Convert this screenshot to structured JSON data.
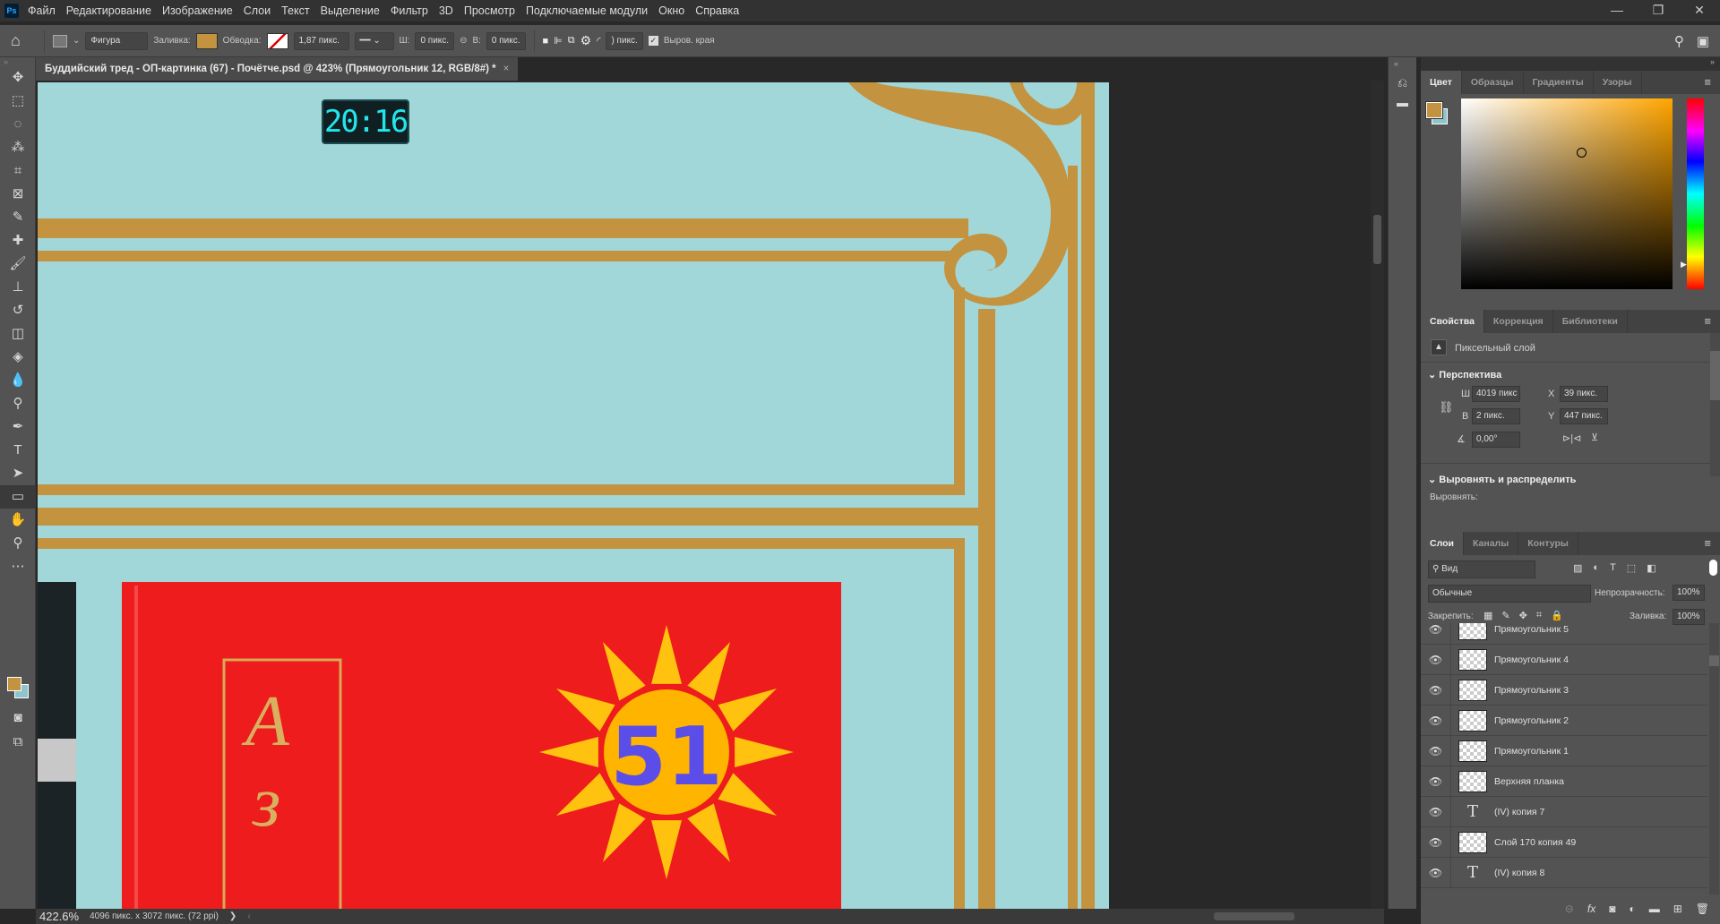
{
  "app": {
    "logo": "Ps"
  },
  "menu": [
    "Файл",
    "Редактирование",
    "Изображение",
    "Слои",
    "Текст",
    "Выделение",
    "Фильтр",
    "3D",
    "Просмотр",
    "Подключаемые модули",
    "Окно",
    "Справка"
  ],
  "window_controls": {
    "minimize": "—",
    "restore": "❐",
    "close": "✕"
  },
  "options": {
    "mode": "Фигура",
    "fill_label": "Заливка:",
    "fill_color": "#c39340",
    "stroke_label": "Обводка:",
    "stroke_width": "1,87 пикс.",
    "w_label": "Ш:",
    "w_value": "0 пикс.",
    "h_label": "В:",
    "h_value": "0 пикс.",
    "radius": ") пикс.",
    "align_edges": "Выров. края",
    "align_edges_checked": true
  },
  "document": {
    "tab_title": "Буддийский тред - ОП-картинка (67) - Почётче.psd @ 423% (Прямоугольник 12, RGB/8#) *",
    "close": "×"
  },
  "canvas": {
    "clock": "20:16",
    "badge_number": "51",
    "background": "#a2d7da",
    "gold": "#c39340"
  },
  "status": {
    "zoom": "422.6%",
    "doc_info": "4096 пикс. x 3072 пикс. (72 ppi)",
    "arrow": "❯"
  },
  "tools": [
    {
      "icon": "move-icon",
      "glyph": "✥"
    },
    {
      "icon": "marquee-icon",
      "glyph": "⬚"
    },
    {
      "icon": "lasso-icon",
      "glyph": "◌"
    },
    {
      "icon": "magic-wand-icon",
      "glyph": "⁂"
    },
    {
      "icon": "crop-icon",
      "glyph": "⌗"
    },
    {
      "icon": "frame-icon",
      "glyph": "⊠"
    },
    {
      "icon": "eyedropper-icon",
      "glyph": "✎"
    },
    {
      "icon": "healing-brush-icon",
      "glyph": "✚"
    },
    {
      "icon": "brush-icon",
      "glyph": "🖌"
    },
    {
      "icon": "stamp-icon",
      "glyph": "⊥"
    },
    {
      "icon": "history-brush-icon",
      "glyph": "↺"
    },
    {
      "icon": "eraser-icon",
      "glyph": "◫"
    },
    {
      "icon": "paint-bucket-icon",
      "glyph": "◈"
    },
    {
      "icon": "blur-icon",
      "glyph": "💧"
    },
    {
      "icon": "dodge-icon",
      "glyph": "⚲"
    },
    {
      "icon": "pen-icon",
      "glyph": "✒"
    },
    {
      "icon": "type-icon",
      "glyph": "T"
    },
    {
      "icon": "path-selection-icon",
      "glyph": "➤"
    },
    {
      "icon": "rectangle-icon",
      "glyph": "▭"
    },
    {
      "icon": "hand-icon",
      "glyph": "✋"
    },
    {
      "icon": "zoom-icon",
      "glyph": "⚲"
    },
    {
      "icon": "more-icon",
      "glyph": "⋯"
    }
  ],
  "colors": {
    "foreground": "#c39340",
    "background": "#8fc4cc"
  },
  "color_panel": {
    "tabs": [
      "Цвет",
      "Образцы",
      "Градиенты",
      "Узоры"
    ],
    "active": 0
  },
  "properties_panel": {
    "tabs": [
      "Свойства",
      "Коррекция",
      "Библиотеки"
    ],
    "layer_type": "Пиксельный слой",
    "section1": "Перспектива",
    "w_label": "Ш",
    "w": "4019 пикс",
    "h_label": "В",
    "h": "2 пикс.",
    "x_label": "X",
    "x": "39 пикс.",
    "y_label": "Y",
    "y": "447 пикс.",
    "angle": "0,00°",
    "section2": "Выровнять и распределить",
    "align_label": "Выровнять:"
  },
  "layers_panel": {
    "tabs": [
      "Слои",
      "Каналы",
      "Контуры"
    ],
    "filter": "Вид",
    "blend_mode": "Обычные",
    "opacity_label": "Непрозрачность:",
    "opacity": "100%",
    "lock_label": "Закрепить:",
    "fill_label": "Заливка:",
    "fill": "100%",
    "layers": [
      {
        "name": "Прямоугольник 5",
        "type": "pixel"
      },
      {
        "name": "Прямоугольник 4",
        "type": "pixel"
      },
      {
        "name": "Прямоугольник 3",
        "type": "pixel"
      },
      {
        "name": "Прямоугольник 2",
        "type": "pixel"
      },
      {
        "name": "Прямоугольник 1",
        "type": "pixel"
      },
      {
        "name": "Верхняя планка",
        "type": "pixel"
      },
      {
        "name": "(IV) копия 7",
        "type": "text"
      },
      {
        "name": "Слой 170 копия 49",
        "type": "pixel"
      },
      {
        "name": "(IV) копия 8",
        "type": "text"
      }
    ]
  }
}
